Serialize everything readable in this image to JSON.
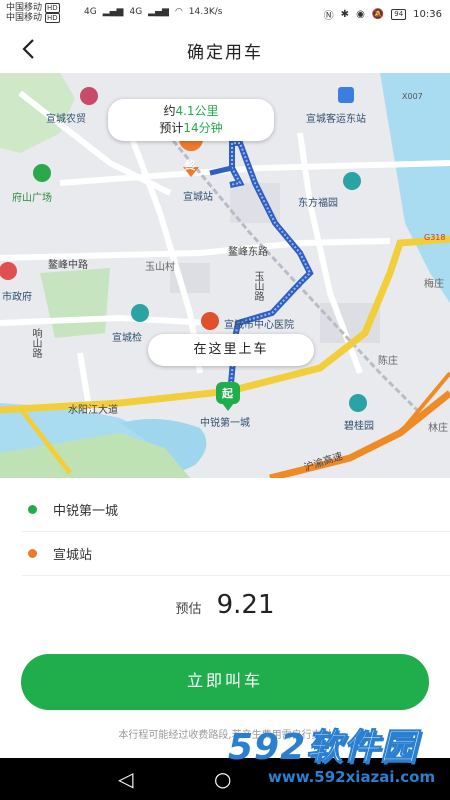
{
  "status_bar": {
    "carrier_1": "中国移动",
    "carrier_2": "中国移动",
    "hd_1": "HD",
    "hd_2": "HD",
    "net_1": "4G",
    "net_2": "4G",
    "speed": "14.3K/s",
    "battery": "94",
    "time": "10:36"
  },
  "header": {
    "title": "确定用车"
  },
  "map": {
    "labels": {
      "farm_trade": "宣城农贸",
      "bus_station_east": "宣城客运东站",
      "fushan_square": "府山广场",
      "dongfang_garden": "东方福园",
      "zhangfeng_east_rd": "鳌峰东路",
      "zhangfeng_mid_rd": "鳌峰中路",
      "yushan_village": "玉山村",
      "yushan_rd": "玉山路",
      "city_gov": "市政府",
      "xuancheng_station": "宣城站",
      "xuancheng_pick": "宣城检",
      "hospital": "宣城市中心医院",
      "chenzhuang": "陈庄",
      "xiangshan_rd": "响山路",
      "shuiyang_rd": "水阳江大道",
      "zhongrui": "中锐第一城",
      "biguiyuan": "碧桂园",
      "expressway": "沪渝高速",
      "x007": "X007",
      "g318": "G318",
      "meizhuang": "梅庄",
      "linzhuang": "林庄"
    },
    "trip_bubble": {
      "distance_prefix": "约",
      "distance": "4.1公里",
      "time_prefix": "预计",
      "time": "14分钟"
    },
    "pickup_bubble": "在这里上车",
    "start_marker": "起",
    "end_marker": "终"
  },
  "trip": {
    "start_name": "中锐第一城",
    "end_name": "宣城站",
    "price_label": "预估",
    "price_value": "9.21",
    "call_button": "立即叫车",
    "note": "本行程可能经过收费路段,若产生费用需自行支付"
  },
  "watermark": {
    "brand_num": "592",
    "brand_text": "软件园",
    "url": "www.592xiazai.com"
  },
  "colors": {
    "accent": "#1fae4b",
    "start_dot": "#1fae4b",
    "end_dot": "#f07a2a",
    "route": "#3b6fd4",
    "water": "#a9dcf0",
    "park": "#c8e6c0"
  }
}
